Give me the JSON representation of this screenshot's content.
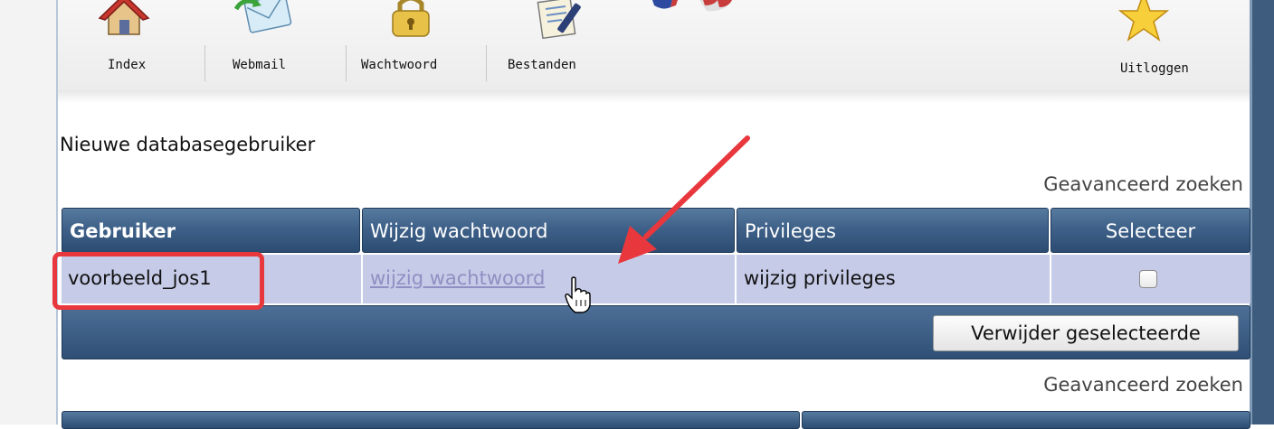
{
  "toolbar": {
    "items": [
      {
        "label": "Index",
        "icon": "house-icon"
      },
      {
        "label": "Webmail",
        "icon": "mail-icon"
      },
      {
        "label": "Wachtwoord",
        "icon": "padlock-icon"
      },
      {
        "label": "Bestanden",
        "icon": "document-pen-icon"
      },
      {
        "label": "Uitloggen",
        "icon": "star-icon"
      }
    ]
  },
  "page": {
    "heading": "Nieuwe databasegebruiker",
    "advanced_search": "Geavanceerd zoeken",
    "advanced_search_bottom": "Geavanceerd zoeken"
  },
  "table": {
    "headers": [
      "Gebruiker",
      "Wijzig wachtwoord",
      "Privileges",
      "Selecteer"
    ],
    "rows": [
      {
        "user": "voorbeeld_jos1",
        "change_password": "wijzig wachtwoord",
        "privileges": "wijzig privileges",
        "selected": false
      }
    ],
    "delete_button": "Verwijder geselecteerde"
  },
  "colors": {
    "header_blue": "#3f6189",
    "row_bg": "#c6cbe8",
    "annotation_red": "#e8383d"
  }
}
